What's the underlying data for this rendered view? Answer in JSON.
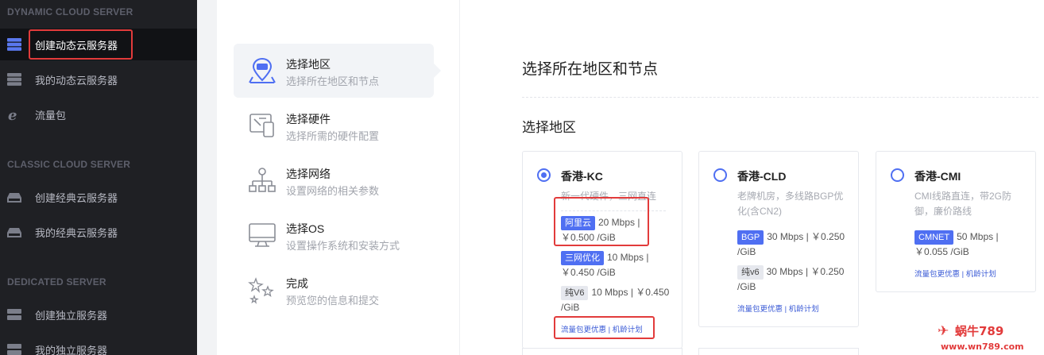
{
  "sidebar": {
    "sections": [
      {
        "title": "DYNAMIC CLOUD SERVER",
        "items": [
          {
            "label": "创建动态云服务器"
          },
          {
            "label": "我的动态云服务器"
          },
          {
            "label": "流量包"
          }
        ]
      },
      {
        "title": "CLASSIC CLOUD SERVER",
        "items": [
          {
            "label": "创建经典云服务器"
          },
          {
            "label": "我的经典云服务器"
          }
        ]
      },
      {
        "title": "DEDICATED SERVER",
        "items": [
          {
            "label": "创建独立服务器"
          },
          {
            "label": "我的独立服务器"
          }
        ]
      }
    ]
  },
  "steps": [
    {
      "title": "选择地区",
      "subtitle": "选择所在地区和节点"
    },
    {
      "title": "选择硬件",
      "subtitle": "选择所需的硬件配置"
    },
    {
      "title": "选择网络",
      "subtitle": "设置网络的相关参数"
    },
    {
      "title": "选择OS",
      "subtitle": "设置操作系统和安装方式"
    },
    {
      "title": "完成",
      "subtitle": "预览您的信息和提交"
    }
  ],
  "main": {
    "title": "选择所在地区和节点",
    "region_title": "选择地区"
  },
  "regions": [
    {
      "name": "香港-KC",
      "selected": true,
      "desc": "新一代硬件，三网直连",
      "lines": [
        {
          "tag": "阿里云",
          "price_a": "20 Mbps |",
          "price_b": "￥0.500 /GiB"
        },
        {
          "tag": "三网优化",
          "price_a": "10 Mbps |",
          "price_b": "￥0.450 /GiB"
        },
        {
          "tag": "纯V6",
          "price_a": "10 Mbps | ￥0.450",
          "price_b": "/GiB"
        }
      ],
      "links": "流量包更优惠 | 机龄计划"
    },
    {
      "name": "香港-CLD",
      "selected": false,
      "desc": "老牌机房，多线路BGP优化(含CN2)",
      "lines": [
        {
          "tag": "BGP",
          "price_a": "30 Mbps | ￥0.250",
          "price_b": "/GiB"
        },
        {
          "tag": "纯v6",
          "price_a": "30 Mbps | ￥0.250",
          "price_b": "/GiB"
        }
      ],
      "links": "流量包更优惠 | 机龄计划"
    },
    {
      "name": "香港-CMI",
      "selected": false,
      "desc": "CMI线路直连，带2G防御，廉价路线",
      "lines": [
        {
          "tag": "CMNET",
          "price_a": "50 Mbps |",
          "price_b": "￥0.055 /GiB"
        }
      ],
      "links": "流量包更优惠 | 机龄计划"
    }
  ],
  "watermark": {
    "text": "蜗牛789",
    "url": "www.wn789.com"
  },
  "colors": {
    "accent": "#4f6ff2",
    "highlight": "#e23b3b",
    "sidebar_bg": "#1f2024"
  }
}
